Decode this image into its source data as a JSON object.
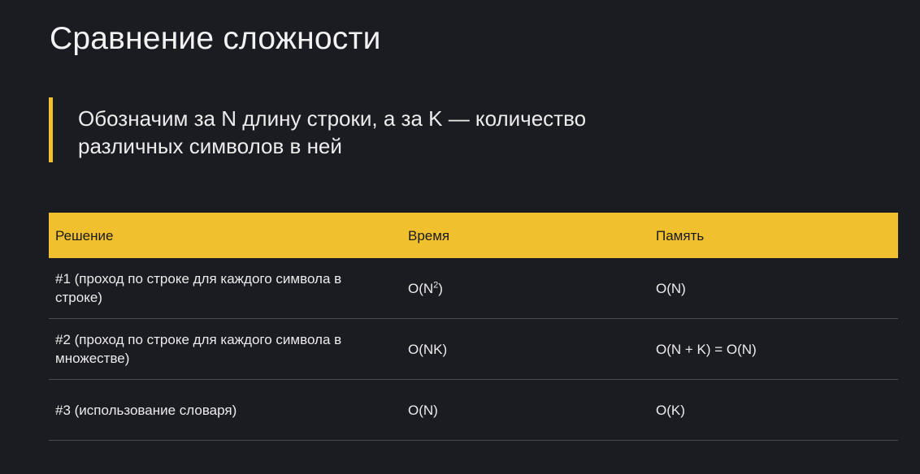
{
  "slide": {
    "title": "Сравнение сложности",
    "note": "Обозначим за N длину строки, а за K — количество различных символов в ней"
  },
  "table": {
    "columns": [
      "Решение",
      "Время",
      "Память"
    ],
    "rows": [
      {
        "solution": "#1 (проход по строке для каждого символа в строке)",
        "time_base": "O(N",
        "time_exp": "2",
        "time_close": ")",
        "memory": "O(N)"
      },
      {
        "solution": "#2 (проход по строке для каждого символа в множестве)",
        "time": "O(NK)",
        "memory": "O(N + K) = O(N)"
      },
      {
        "solution": "#3 (использование словаря)",
        "time": "O(N)",
        "memory": "O(K)"
      }
    ]
  },
  "colors": {
    "background": "#1b1b22",
    "accent": "#f0c02f",
    "text": "#ececec",
    "divider": "#4a4a52"
  }
}
